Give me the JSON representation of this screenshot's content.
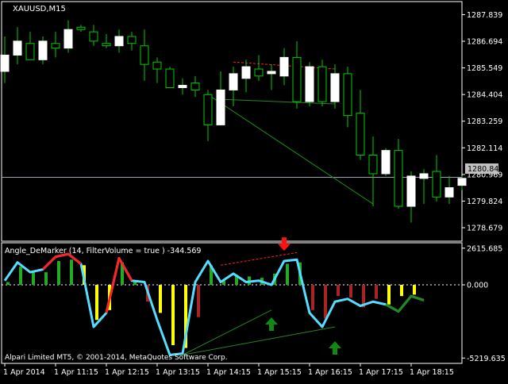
{
  "main_title": "XAUUSD,M15",
  "indicator_title": "Angle_DeMarker (14, FilterVolume = true ) -344.569",
  "copyright": "Alpari Limited MT5, © 2001-2014, MetaQuotes Software Corp.",
  "current_price_label": "1280.846",
  "colors": {
    "background": "#000000",
    "bull": "#ffffff",
    "bear": "#000000",
    "wick": "#00cc00",
    "line": "#55ddff",
    "line_red": "#ff2222",
    "line_green": "#228822",
    "hist_green": "#22aa22",
    "hist_yellow": "#ffff00",
    "hist_red": "#aa2222",
    "arrow_up": "#118811",
    "arrow_down": "#ff1111",
    "text": "#ffffff"
  },
  "chart_data": [
    {
      "type": "candlestick",
      "title": "XAUUSD,M15",
      "y_ticks": [
        "1287.839",
        "1286.694",
        "1285.549",
        "1284.404",
        "1283.259",
        "1282.114",
        "1280.969",
        "1279.824",
        "1278.679"
      ],
      "y_tick_values": [
        1287.839,
        1286.694,
        1285.549,
        1284.404,
        1283.259,
        1282.114,
        1280.969,
        1279.824,
        1278.679
      ],
      "ylim": [
        1278.1,
        1288.4
      ],
      "current_price": 1280.846,
      "candles": [
        {
          "o": 1285.4,
          "h": 1286.9,
          "l": 1284.9,
          "c": 1286.1
        },
        {
          "o": 1286.1,
          "h": 1287.3,
          "l": 1285.7,
          "c": 1286.7
        },
        {
          "o": 1286.6,
          "h": 1287.1,
          "l": 1285.9,
          "c": 1285.9
        },
        {
          "o": 1285.9,
          "h": 1286.9,
          "l": 1285.7,
          "c": 1286.7
        },
        {
          "o": 1286.6,
          "h": 1287.1,
          "l": 1286.0,
          "c": 1286.4
        },
        {
          "o": 1286.4,
          "h": 1287.6,
          "l": 1286.2,
          "c": 1287.2
        },
        {
          "o": 1287.3,
          "h": 1287.4,
          "l": 1287.1,
          "c": 1287.2
        },
        {
          "o": 1287.1,
          "h": 1287.4,
          "l": 1286.5,
          "c": 1286.7
        },
        {
          "o": 1286.6,
          "h": 1287.0,
          "l": 1286.4,
          "c": 1286.5
        },
        {
          "o": 1286.5,
          "h": 1287.2,
          "l": 1286.2,
          "c": 1286.9
        },
        {
          "o": 1286.9,
          "h": 1287.1,
          "l": 1286.3,
          "c": 1286.6
        },
        {
          "o": 1286.5,
          "h": 1287.2,
          "l": 1285.0,
          "c": 1285.7
        },
        {
          "o": 1285.8,
          "h": 1286.0,
          "l": 1284.9,
          "c": 1285.5
        },
        {
          "o": 1285.5,
          "h": 1285.6,
          "l": 1284.8,
          "c": 1284.7
        },
        {
          "o": 1284.7,
          "h": 1285.1,
          "l": 1284.4,
          "c": 1284.8
        },
        {
          "o": 1284.9,
          "h": 1285.2,
          "l": 1284.3,
          "c": 1284.6
        },
        {
          "o": 1284.4,
          "h": 1284.6,
          "l": 1282.4,
          "c": 1283.1
        },
        {
          "o": 1283.1,
          "h": 1285.4,
          "l": 1283.1,
          "c": 1284.6
        },
        {
          "o": 1284.6,
          "h": 1285.6,
          "l": 1283.9,
          "c": 1285.3
        },
        {
          "o": 1285.1,
          "h": 1285.9,
          "l": 1284.5,
          "c": 1285.6
        },
        {
          "o": 1285.5,
          "h": 1286.1,
          "l": 1285.0,
          "c": 1285.2
        },
        {
          "o": 1285.3,
          "h": 1285.7,
          "l": 1284.6,
          "c": 1285.4
        },
        {
          "o": 1285.2,
          "h": 1286.4,
          "l": 1284.8,
          "c": 1286.0
        },
        {
          "o": 1286.0,
          "h": 1286.7,
          "l": 1283.8,
          "c": 1284.1
        },
        {
          "o": 1284.1,
          "h": 1285.8,
          "l": 1283.9,
          "c": 1285.6
        },
        {
          "o": 1285.6,
          "h": 1285.9,
          "l": 1283.9,
          "c": 1284.1
        },
        {
          "o": 1284.1,
          "h": 1285.7,
          "l": 1283.8,
          "c": 1285.3
        },
        {
          "o": 1285.3,
          "h": 1285.6,
          "l": 1283.0,
          "c": 1283.5
        },
        {
          "o": 1283.6,
          "h": 1284.6,
          "l": 1281.6,
          "c": 1281.8
        },
        {
          "o": 1281.8,
          "h": 1282.6,
          "l": 1279.6,
          "c": 1281.0
        },
        {
          "o": 1281.0,
          "h": 1282.1,
          "l": 1280.9,
          "c": 1282.0
        },
        {
          "o": 1282.0,
          "h": 1282.5,
          "l": 1279.5,
          "c": 1279.6
        },
        {
          "o": 1279.6,
          "h": 1281.1,
          "l": 1278.9,
          "c": 1280.9
        },
        {
          "o": 1280.8,
          "h": 1281.2,
          "l": 1279.7,
          "c": 1281.0
        },
        {
          "o": 1281.1,
          "h": 1281.8,
          "l": 1279.8,
          "c": 1280.0
        },
        {
          "o": 1280.0,
          "h": 1280.9,
          "l": 1279.7,
          "c": 1280.4
        },
        {
          "o": 1280.5,
          "h": 1280.9,
          "l": 1280.3,
          "c": 1280.8
        }
      ],
      "trendlines_main": [
        {
          "from": [
            16,
            1284.4
          ],
          "to": [
            29,
            1279.7
          ],
          "color": "#228822",
          "dash": false
        },
        {
          "from": [
            17,
            1284.2
          ],
          "to": [
            26,
            1284.0
          ],
          "color": "#228822",
          "dash": false
        },
        {
          "from": [
            18,
            1285.8
          ],
          "to": [
            26,
            1285.5
          ],
          "color": "#ff2222",
          "dash": true
        }
      ]
    },
    {
      "type": "line+histogram",
      "title": "Angle_DeMarker (14, FilterVolume = true ) -344.569",
      "y_ticks": [
        "2615.685",
        "0.000",
        "-5219.635"
      ],
      "y_tick_values": [
        2615.685,
        0,
        -5219.635
      ],
      "ylim": [
        -5600,
        3000
      ],
      "line_values": [
        300,
        1600,
        900,
        1100,
        2000,
        2200,
        1500,
        -3000,
        -2000,
        1900,
        300,
        200,
        -2500,
        -5000,
        -4900,
        200,
        1700,
        200,
        800,
        200,
        300,
        0,
        1700,
        1800,
        -2000,
        -3000,
        -1200,
        -1000,
        -1500,
        -1200,
        -1400,
        -1900,
        -800,
        -1100
      ],
      "line_color_segments": [
        {
          "from": 3,
          "to": 6,
          "color": "#ff2222"
        },
        {
          "from": 8,
          "to": 10,
          "color": "#ff2222"
        },
        {
          "from": 30,
          "to": 33,
          "color": "#228822"
        }
      ],
      "hist_values": [
        200,
        1300,
        900,
        900,
        1700,
        1800,
        1400,
        -2500,
        -1800,
        1600,
        200,
        -1200,
        -2000,
        -4300,
        -4500,
        -2300,
        1400,
        300,
        700,
        600,
        500,
        800,
        1500,
        1600,
        -1800,
        -2400,
        -800,
        -900,
        -1600,
        -1000,
        -1400,
        -800,
        -700
      ],
      "hist_colors": [
        "green",
        "green",
        "green",
        "green",
        "green",
        "green",
        "yellow",
        "yellow",
        "yellow",
        "green",
        "green",
        "red",
        "yellow",
        "yellow",
        "yellow",
        "red",
        "green",
        "green",
        "green",
        "green",
        "green",
        "green",
        "green",
        "green",
        "red",
        "red",
        "red",
        "red",
        "red",
        "red",
        "yellow",
        "yellow",
        "yellow"
      ],
      "arrows": [
        {
          "x": 22,
          "y": 2700,
          "dir": "down"
        },
        {
          "x": 21,
          "y": -2600,
          "dir": "up"
        },
        {
          "x": 26,
          "y": -4300,
          "dir": "up"
        }
      ],
      "trendlines_ind": [
        {
          "from": [
            14,
            -5000
          ],
          "to": [
            21,
            -1800
          ],
          "color": "#228822",
          "dash": false
        },
        {
          "from": [
            14,
            -5000
          ],
          "to": [
            26,
            -3000
          ],
          "color": "#228822",
          "dash": false
        },
        {
          "from": [
            17,
            1400
          ],
          "to": [
            23,
            2300
          ],
          "color": "#ff2222",
          "dash": true
        }
      ]
    }
  ],
  "x_ticks": [
    "1 Apr 2014",
    "1 Apr 11:15",
    "1 Apr 12:15",
    "1 Apr 13:15",
    "1 Apr 14:15",
    "1 Apr 15:15",
    "1 Apr 16:15",
    "1 Apr 17:15",
    "1 Apr 18:15"
  ],
  "x_tick_index": [
    0,
    4,
    8,
    12,
    16,
    20,
    24,
    28,
    32
  ]
}
